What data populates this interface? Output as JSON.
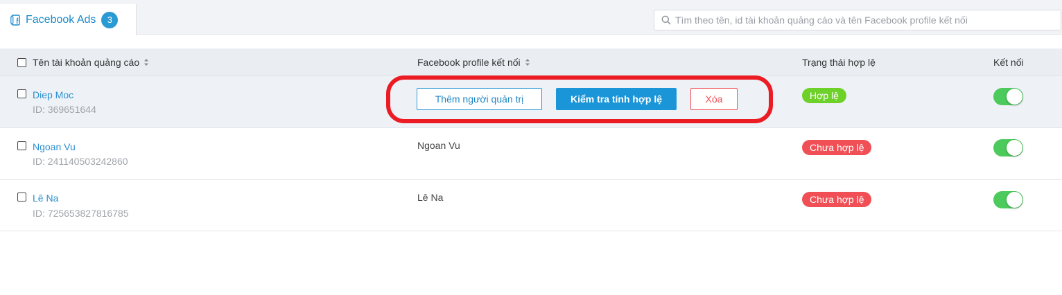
{
  "tab": {
    "label": "Facebook Ads",
    "count": "3"
  },
  "search": {
    "placeholder": "Tìm theo tên, id tài khoản quảng cáo và tên Facebook profile kết nối"
  },
  "columns": {
    "account": "Tên tài khoản quảng cáo",
    "profile": "Facebook profile kết nối",
    "status": "Trạng thái hợp lệ",
    "connect": "Kết nối"
  },
  "actions": {
    "add_admin": "Thêm người quản trị",
    "check_valid": "Kiểm tra tính hợp lệ",
    "delete": "Xóa"
  },
  "rows": [
    {
      "name": "Diep Moc",
      "id": "ID: 369651644",
      "profile": "",
      "status": "Hợp lệ",
      "status_type": "valid",
      "connected": true
    },
    {
      "name": "Ngoan Vu",
      "id": "ID: 241140503242860",
      "profile": "Ngoan Vu",
      "status": "Chưa hợp lệ",
      "status_type": "invalid",
      "connected": true
    },
    {
      "name": "Lê Na",
      "id": "ID: 725653827816785",
      "profile": "Lê Na",
      "status": "Chưa hợp lệ",
      "status_type": "invalid",
      "connected": true
    }
  ],
  "colors": {
    "accent": "#1a95d8",
    "valid": "#6ed12a",
    "invalid": "#ef4f55",
    "toggle_on": "#4cca5c",
    "annotation": "#ec1c24"
  },
  "icons": {
    "tab": "facebook-page-icon",
    "search": "search-icon",
    "sort": "sort-icon"
  }
}
